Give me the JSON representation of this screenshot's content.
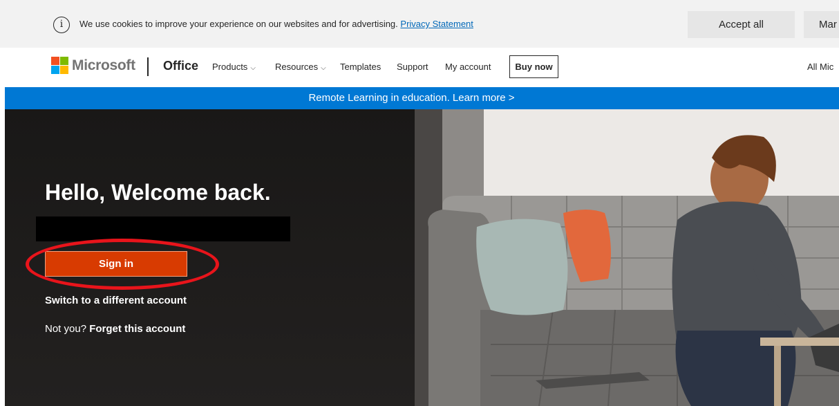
{
  "cookie_bar": {
    "info_icon": "info-circle-icon",
    "message": "We use cookies to improve your experience on our websites and for advertising.",
    "privacy_link": "Privacy Statement",
    "accept_label": "Accept all",
    "manage_label": "Mar"
  },
  "header": {
    "brand": "Microsoft",
    "product": "Office",
    "nav": [
      {
        "label": "Products",
        "dropdown": true
      },
      {
        "label": "Resources",
        "dropdown": true
      },
      {
        "label": "Templates",
        "dropdown": false
      },
      {
        "label": "Support",
        "dropdown": false
      },
      {
        "label": "My account",
        "dropdown": false
      }
    ],
    "buy_label": "Buy now",
    "all_microsoft": "All Mic",
    "chevron": "⌵"
  },
  "promo": {
    "text": "Remote Learning in education. Learn more >"
  },
  "hero": {
    "headline": "Hello, Welcome back.",
    "signin_label": "Sign in",
    "switch_account": "Switch to a different account",
    "not_you": "Not you?",
    "forget_account": "Forget this account"
  },
  "colors": {
    "brand_blue": "#0078d4",
    "signin_orange": "#d83b01",
    "highlight_ring": "#e8141b",
    "link_blue": "#0067b8"
  }
}
